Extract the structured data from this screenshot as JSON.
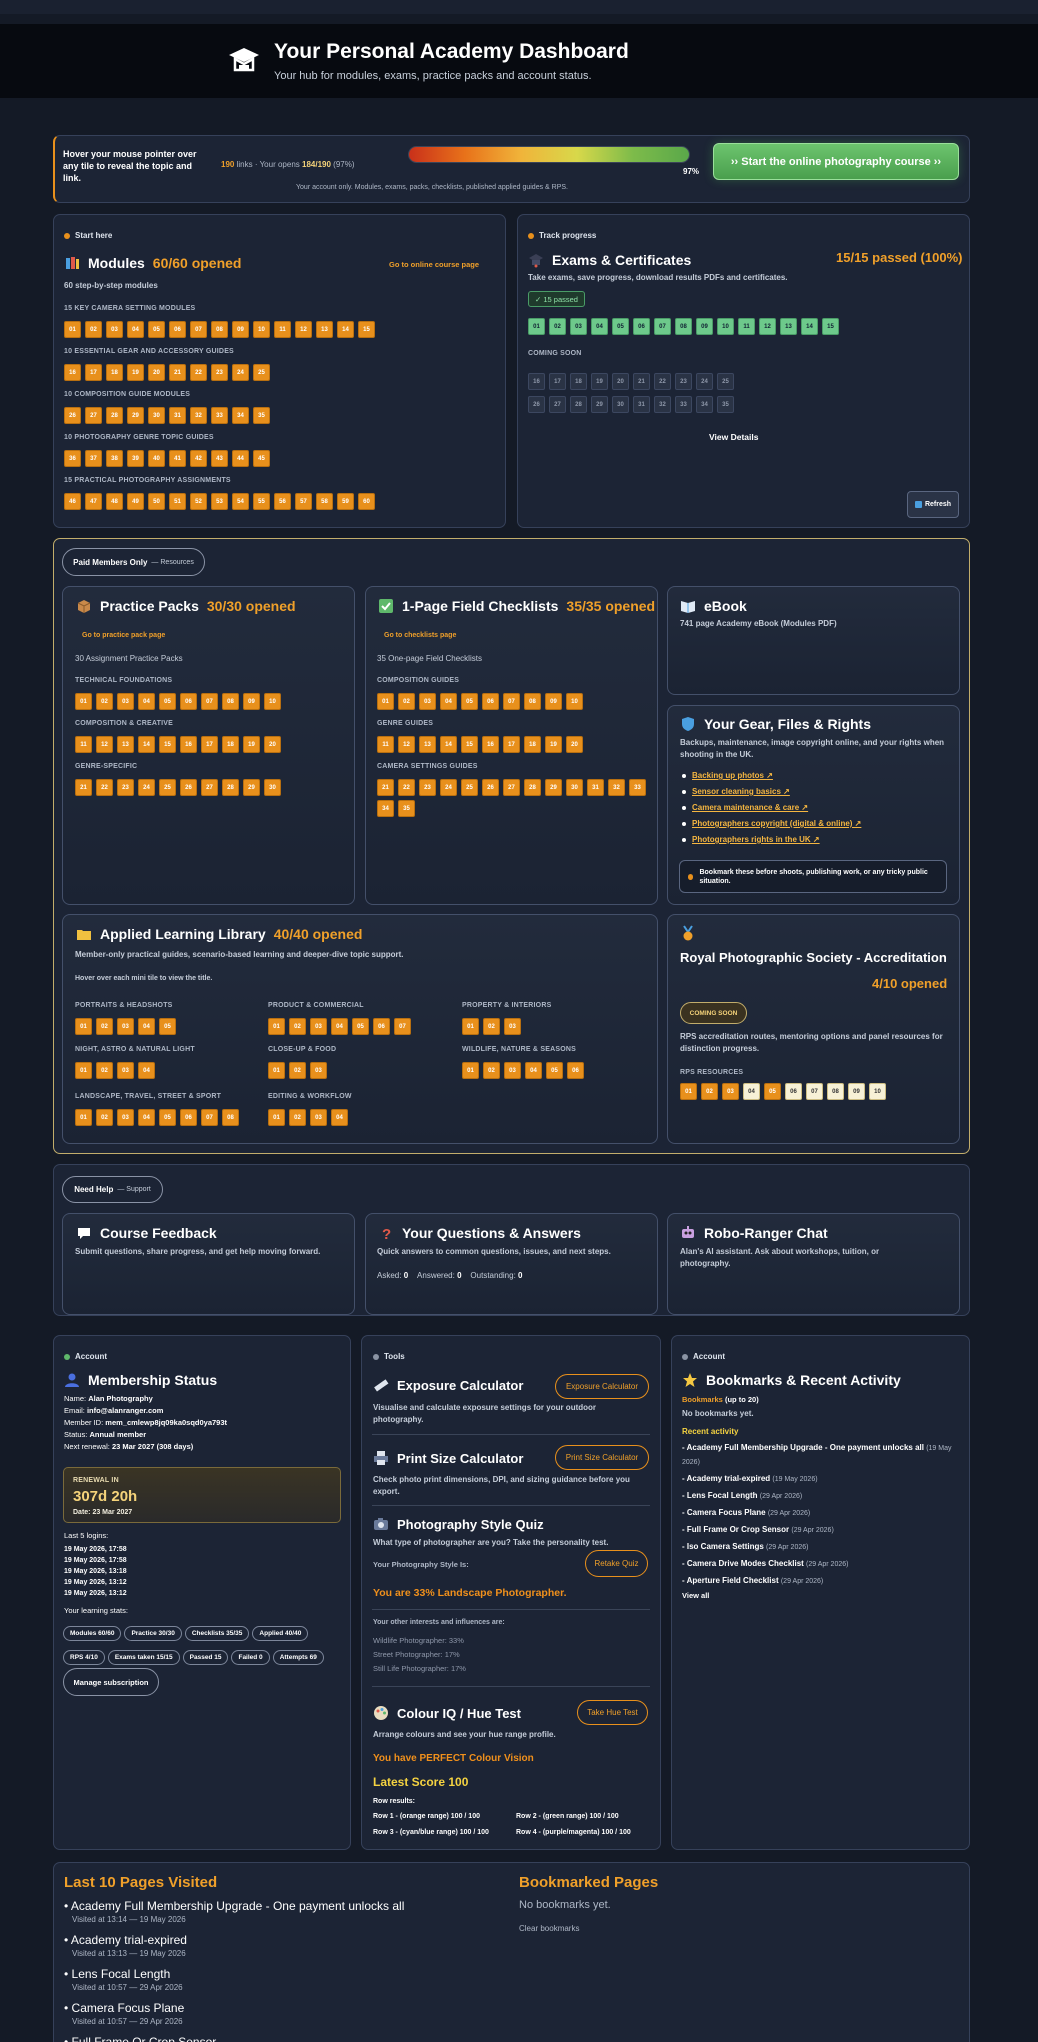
{
  "header": {
    "title": "Your Personal Academy Dashboard",
    "subtitle": "Your hub for modules, exams, practice packs and account status."
  },
  "status": {
    "hover_hint": "Hover your mouse pointer over any tile to reveal the topic and link.",
    "links_count": "190",
    "links_text": "links",
    "opens_text": "Your opens",
    "opens_value": "184/190",
    "opens_pct": "(97%)",
    "progress_pct": "97%",
    "progress_fraction": 0.97,
    "note": "Your account only. Modules, exams, packs, checklists, published applied guides & RPS.",
    "cta": "›› Start the online photography course ››"
  },
  "modules": {
    "kicker": "Start here",
    "title": "Modules",
    "stat": "60/60 opened",
    "link": "Go to online course page",
    "subtitle": "60 step-by-step modules",
    "groups": [
      {
        "label": "15 KEY CAMERA SETTING MODULES",
        "tiles": [
          "01",
          "02",
          "03",
          "04",
          "05",
          "06",
          "07",
          "08",
          "09",
          "10",
          "11",
          "12",
          "13",
          "14",
          "15"
        ]
      },
      {
        "label": "10 ESSENTIAL GEAR AND ACCESSORY GUIDES",
        "tiles": [
          "16",
          "17",
          "18",
          "19",
          "20",
          "21",
          "22",
          "23",
          "24",
          "25"
        ]
      },
      {
        "label": "10 COMPOSITION GUIDE MODULES",
        "tiles": [
          "26",
          "27",
          "28",
          "29",
          "30",
          "31",
          "32",
          "33",
          "34",
          "35"
        ]
      },
      {
        "label": "10 PHOTOGRAPHY GENRE TOPIC GUIDES",
        "tiles": [
          "36",
          "37",
          "38",
          "39",
          "40",
          "41",
          "42",
          "43",
          "44",
          "45"
        ]
      },
      {
        "label": "15 PRACTICAL PHOTOGRAPHY ASSIGNMENTS",
        "tiles": [
          "46",
          "47",
          "48",
          "49",
          "50",
          "51",
          "52",
          "53",
          "54",
          "55",
          "56",
          "57",
          "58",
          "59",
          "60"
        ]
      }
    ]
  },
  "exams": {
    "kicker": "Track progress",
    "title": "Exams & Certificates",
    "stat": "15/15 passed (100%)",
    "subtitle": "Take exams, save progress, download results PDFs and certificates.",
    "badge": "✓ 15 passed",
    "passed_tiles": [
      "01",
      "02",
      "03",
      "04",
      "05",
      "06",
      "07",
      "08",
      "09",
      "10",
      "11",
      "12",
      "13",
      "14",
      "15"
    ],
    "soon_label": "COMING SOON",
    "soon_row1": [
      "16",
      "17",
      "18",
      "19",
      "20",
      "21",
      "22",
      "23",
      "24",
      "25"
    ],
    "soon_row2": [
      "26",
      "27",
      "28",
      "29",
      "30",
      "31",
      "32",
      "33",
      "34",
      "35"
    ],
    "view_details": "View Details",
    "refresh": "Refresh"
  },
  "resources": {
    "pill": "Paid Members Only",
    "pill_sub": "— Resources"
  },
  "packs": {
    "title": "Practice Packs",
    "stat": "30/30 opened",
    "link": "Go to practice pack page",
    "subtitle": "30 Assignment Practice Packs",
    "groups": [
      {
        "label": "TECHNICAL FOUNDATIONS",
        "tiles": [
          "01",
          "02",
          "03",
          "04",
          "05",
          "06",
          "07",
          "08",
          "09",
          "10"
        ]
      },
      {
        "label": "COMPOSITION & CREATIVE",
        "tiles": [
          "11",
          "12",
          "13",
          "14",
          "15",
          "16",
          "17",
          "18",
          "19",
          "20"
        ]
      },
      {
        "label": "GENRE-SPECIFIC",
        "tiles": [
          "21",
          "22",
          "23",
          "24",
          "25",
          "26",
          "27",
          "28",
          "29",
          "30"
        ]
      }
    ]
  },
  "checklists": {
    "title": "1-Page Field Checklists",
    "stat": "35/35 opened",
    "link": "Go to checklists page",
    "subtitle": "35 One-page Field Checklists",
    "groups": [
      {
        "label": "COMPOSITION GUIDES",
        "tiles": [
          "01",
          "02",
          "03",
          "04",
          "05",
          "06",
          "07",
          "08",
          "09",
          "10"
        ]
      },
      {
        "label": "GENRE GUIDES",
        "tiles": [
          "11",
          "12",
          "13",
          "14",
          "15",
          "16",
          "17",
          "18",
          "19",
          "20"
        ]
      },
      {
        "label": "CAMERA SETTINGS GUIDES",
        "tiles": [
          "21",
          "22",
          "23",
          "24",
          "25",
          "26",
          "27",
          "28",
          "29",
          "30",
          "31",
          "32",
          "33",
          "34",
          "35"
        ]
      }
    ]
  },
  "ebook": {
    "title": "eBook",
    "subtitle": "741 page Academy eBook (Modules PDF)"
  },
  "gear": {
    "title": "Your Gear, Files & Rights",
    "subtitle": "Backups, maintenance, image copyright online, and your rights when shooting in the UK.",
    "links": [
      "Backing up photos ↗",
      "Sensor cleaning basics ↗",
      "Camera maintenance & care ↗",
      "Photographers copyright (digital & online) ↗",
      "Photographers rights in the UK ↗"
    ],
    "note": "Bookmark these before shoots, publishing work, or any tricky public situation."
  },
  "library": {
    "title": "Applied Learning Library",
    "stat": "40/40 opened",
    "subtitle": "Member-only practical guides, scenario-based learning and deeper-dive topic support.",
    "hint": "Hover over each mini tile to view the title.",
    "groups": [
      {
        "label": "PORTRAITS & HEADSHOTS",
        "tiles": [
          "01",
          "02",
          "03",
          "04",
          "05"
        ]
      },
      {
        "label": "PRODUCT & COMMERCIAL",
        "tiles": [
          "01",
          "02",
          "03",
          "04",
          "05",
          "06",
          "07"
        ]
      },
      {
        "label": "PROPERTY & INTERIORS",
        "tiles": [
          "01",
          "02",
          "03"
        ]
      },
      {
        "label": "NIGHT, ASTRO & NATURAL LIGHT",
        "tiles": [
          "01",
          "02",
          "03",
          "04"
        ]
      },
      {
        "label": "CLOSE-UP & FOOD",
        "tiles": [
          "01",
          "02",
          "03"
        ]
      },
      {
        "label": "WILDLIFE, NATURE & SEASONS",
        "tiles": [
          "01",
          "02",
          "03",
          "04",
          "05",
          "06"
        ]
      },
      {
        "label": "LANDSCAPE, TRAVEL, STREET & SPORT",
        "tiles": [
          "01",
          "02",
          "03",
          "04",
          "05",
          "06",
          "07",
          "08"
        ]
      },
      {
        "label": "EDITING & WORKFLOW",
        "tiles": [
          "01",
          "02",
          "03",
          "04"
        ]
      }
    ]
  },
  "rps": {
    "title": "Royal Photographic Society - Accreditation",
    "stat": "4/10 opened",
    "badge": "COMING SOON",
    "subtitle": "RPS accreditation routes, mentoring options and panel resources for distinction progress.",
    "sec": "RPS RESOURCES",
    "opened": [
      "01",
      "02",
      "03",
      "05"
    ],
    "unopened": [
      "04",
      "06",
      "07",
      "08",
      "09",
      "10"
    ]
  },
  "support": {
    "pill": "Need Help",
    "pill_sub": "— Support"
  },
  "feedback": {
    "title": "Course Feedback",
    "subtitle": "Submit questions, share progress, and get help moving forward."
  },
  "qa": {
    "title": "Your Questions & Answers",
    "subtitle": "Quick answers to common questions, issues, and next steps.",
    "asked_label": "Asked:",
    "asked": "0",
    "answered_label": "Answered:",
    "answered": "0",
    "outstanding_label": "Outstanding:",
    "outstanding": "0"
  },
  "robo": {
    "title": "Robo-Ranger Chat",
    "subtitle": "Alan's AI assistant. Ask about workshops, tuition, or photography."
  },
  "membership": {
    "kicker": "Account",
    "title": "Membership Status",
    "name_l": "Name:",
    "name": "Alan Photography",
    "email_l": "Email:",
    "email": "info@alanranger.com",
    "id_l": "Member ID:",
    "id": "mem_cmlewp8jq09ka0sqd0ya793t",
    "status_l": "Status:",
    "status": "Annual member",
    "renew_l": "Next renewal:",
    "renew": "23 Mar 2027 (308 days)",
    "box_label": "RENEWAL IN",
    "box_value": "307d 20h",
    "box_date": "Date: 23 Mar 2027",
    "logins_label": "Last 5 logins:",
    "logins": [
      "19 May 2026, 17:58",
      "19 May 2026, 17:58",
      "19 May 2026, 13:18",
      "19 May 2026, 13:12",
      "19 May 2026, 13:12"
    ],
    "stats_label": "Your learning stats:",
    "chips": [
      "Modules 60/60",
      "Practice 30/30",
      "Checklists 35/35",
      "Applied 40/40",
      "RPS 4/10",
      "Exams taken 15/15",
      "Passed 15",
      "Failed 0",
      "Attempts 69"
    ],
    "manage": "Manage subscription"
  },
  "tools": {
    "kicker": "Tools",
    "exp_title": "Exposure Calculator",
    "exp_btn": "Exposure Calculator",
    "exp_sub": "Visualise and calculate exposure settings for your outdoor photography.",
    "print_title": "Print Size Calculator",
    "print_btn": "Print Size Calculator",
    "print_sub": "Check photo print dimensions, DPI, and sizing guidance before you export.",
    "quiz_title": "Photography Style Quiz",
    "quiz_sub": "What type of photographer are you? Take the personality test.",
    "quiz_style_l": "Your Photography Style Is:",
    "quiz_btn": "Retake Quiz",
    "quiz_result": "You are 33% Landscape Photographer.",
    "quiz_other_l": "Your other interests and influences are:",
    "quiz_other": [
      "Wildlife Photographer: 33%",
      "Street Photographer: 17%",
      "Still Life Photographer: 17%"
    ],
    "hue_title": "Colour IQ / Hue Test",
    "hue_btn": "Take Hue Test",
    "hue_sub": "Arrange colours and see your hue range profile.",
    "hue_result": "You have PERFECT Colour Vision",
    "hue_score": "Latest Score 100",
    "hue_rows_l": "Row results:",
    "hue_rows": [
      "Row 1 - (orange range) 100 / 100",
      "Row 2 - (green range) 100 / 100",
      "Row 3 - (cyan/blue range) 100 / 100",
      "Row 4 - (purple/magenta) 100 / 100"
    ]
  },
  "bookmarks": {
    "kicker": "Account",
    "title": "Bookmarks & Recent Activity",
    "bm_label": "Bookmarks",
    "bm_sub": "(up to 20)",
    "bm_empty": "No bookmarks yet.",
    "recent_label": "Recent activity",
    "recent": [
      {
        "t": "- Academy Full Membership Upgrade - One payment unlocks all",
        "d": "(19 May 2026)"
      },
      {
        "t": "- Academy trial-expired",
        "d": "(19 May 2026)"
      },
      {
        "t": "- Lens Focal Length",
        "d": "(29 Apr 2026)"
      },
      {
        "t": "- Camera Focus Plane",
        "d": "(29 Apr 2026)"
      },
      {
        "t": "- Full Frame Or Crop Sensor",
        "d": "(29 Apr 2026)"
      },
      {
        "t": "- Iso Camera Settings",
        "d": "(29 Apr 2026)"
      },
      {
        "t": "- Camera Drive Modes Checklist",
        "d": "(29 Apr 2026)"
      },
      {
        "t": "- Aperture Field Checklist",
        "d": "(29 Apr 2026)"
      }
    ],
    "view_all": "View all"
  },
  "last10": {
    "title": "Last 10 Pages Visited",
    "items": [
      {
        "t": "• Academy Full Membership Upgrade - One payment unlocks all",
        "d": "Visited at 13:14 — 19 May 2026"
      },
      {
        "t": "• Academy trial-expired",
        "d": "Visited at 13:13 — 19 May 2026"
      },
      {
        "t": "• Lens Focal Length",
        "d": "Visited at 10:57 — 29 Apr 2026"
      },
      {
        "t": "• Camera Focus Plane",
        "d": "Visited at 10:57 — 29 Apr 2026"
      },
      {
        "t": "• Full Frame Or Crop Sensor",
        "d": ""
      }
    ]
  },
  "bookmarked": {
    "title": "Bookmarked Pages",
    "empty": "No bookmarks yet.",
    "clear": "Clear bookmarks"
  }
}
